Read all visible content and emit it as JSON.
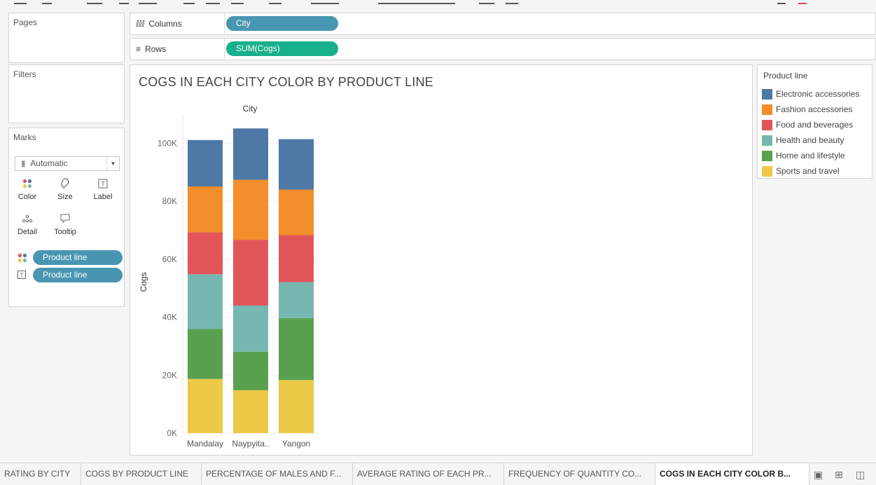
{
  "sidebar": {
    "pages_title": "Pages",
    "filters_title": "Filters",
    "marks": {
      "title": "Marks",
      "mark_type": "Automatic",
      "buttons": [
        {
          "label": "Color",
          "icon": "color-dots-icon"
        },
        {
          "label": "Size",
          "icon": "size-icon"
        },
        {
          "label": "Label",
          "icon": "label-icon"
        },
        {
          "label": "Detail",
          "icon": "detail-icon"
        },
        {
          "label": "Tooltip",
          "icon": "tooltip-icon"
        }
      ],
      "pills": [
        {
          "icon": "color-dots-icon",
          "label": "Product line"
        },
        {
          "icon": "label-icon",
          "label": "Product line"
        }
      ]
    }
  },
  "shelves": {
    "columns": {
      "label": "Columns",
      "pill": "City"
    },
    "rows": {
      "label": "Rows",
      "pill": "SUM(Cogs)"
    }
  },
  "legend": {
    "title": "Product line",
    "items": [
      {
        "label": "Electronic accessories",
        "color": "#4e79a7"
      },
      {
        "label": "Fashion accessories",
        "color": "#f28e2b"
      },
      {
        "label": "Food and beverages",
        "color": "#e15759"
      },
      {
        "label": "Health and beauty",
        "color": "#76b7b2"
      },
      {
        "label": "Home and lifestyle",
        "color": "#59a14f"
      },
      {
        "label": "Sports and travel",
        "color": "#edc948"
      }
    ]
  },
  "chart_data": {
    "type": "bar",
    "stacked": true,
    "title": "COGS IN EACH CITY COLOR BY PRODUCT LINE",
    "column_header": "City",
    "ylabel": "Cogs",
    "xlabel": "",
    "categories": [
      "Mandalay",
      "Naypyita..",
      "Yangon"
    ],
    "ylim": [
      0,
      110000
    ],
    "yticks": [
      0,
      20000,
      40000,
      60000,
      80000,
      100000
    ],
    "ytick_labels": [
      "0K",
      "20K",
      "40K",
      "60K",
      "80K",
      "100K"
    ],
    "series": [
      {
        "name": "Sports and travel",
        "color": "#edc948",
        "values": [
          18700,
          14800,
          18300
        ]
      },
      {
        "name": "Home and lifestyle",
        "color": "#59a14f",
        "values": [
          17200,
          13300,
          21400
        ]
      },
      {
        "name": "Health and beauty",
        "color": "#76b7b2",
        "values": [
          18900,
          15900,
          12400
        ]
      },
      {
        "name": "Food and beverages",
        "color": "#e15759",
        "values": [
          14500,
          22700,
          16200
        ]
      },
      {
        "name": "Fashion accessories",
        "color": "#f28e2b",
        "values": [
          15800,
          20700,
          15700
        ]
      },
      {
        "name": "Electronic accessories",
        "color": "#4e79a7",
        "values": [
          16000,
          17700,
          17400
        ]
      }
    ]
  },
  "tabs": [
    {
      "label": "RATING BY CITY",
      "active": false
    },
    {
      "label": "COGS BY PRODUCT LINE",
      "active": false
    },
    {
      "label": "PERCENTAGE OF MALES AND F...",
      "active": false
    },
    {
      "label": "AVERAGE RATING OF EACH PR...",
      "active": false
    },
    {
      "label": "FREQUENCY OF QUANTITY CO...",
      "active": false
    },
    {
      "label": "COGS IN EACH CITY COLOR B...",
      "active": true
    }
  ]
}
